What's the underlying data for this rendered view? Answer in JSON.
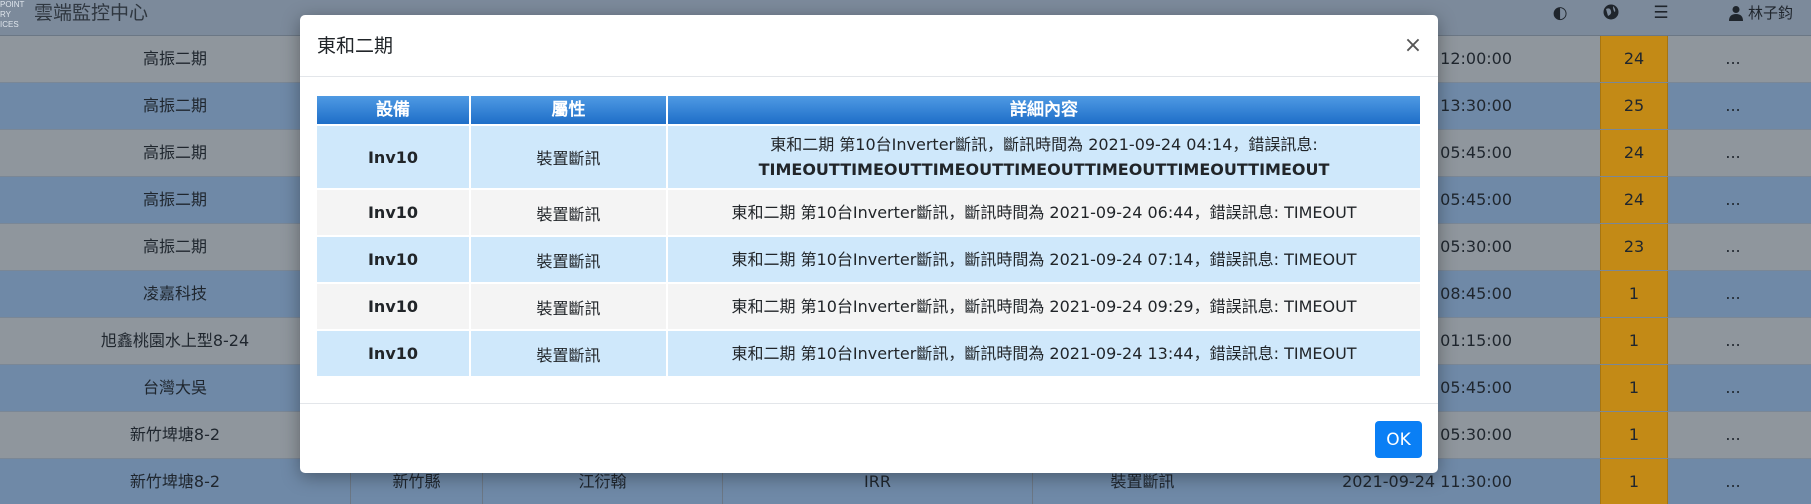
{
  "app": {
    "title": "雲端監控中心",
    "logo_text": "POINT\nRY\nICES",
    "nav_icons": [
      "contrast-icon",
      "globe-icon",
      "menu-icon"
    ],
    "user_name": "林子鈞"
  },
  "background_table": {
    "rows": [
      {
        "site": "高振二期",
        "time": "12:00:00",
        "count": "24",
        "more": "..."
      },
      {
        "site": "高振二期",
        "time": "13:30:00",
        "count": "25",
        "more": "..."
      },
      {
        "site": "高振二期",
        "time": "05:45:00",
        "count": "24",
        "more": "..."
      },
      {
        "site": "高振二期",
        "time": "05:45:00",
        "count": "24",
        "more": "..."
      },
      {
        "site": "高振二期",
        "time": "05:30:00",
        "count": "23",
        "more": "..."
      },
      {
        "site": "凌嘉科技",
        "time": "08:45:00",
        "count": "1",
        "more": "..."
      },
      {
        "site": "旭鑫桃園水上型8-24",
        "time": "01:15:00",
        "count": "1",
        "more": "..."
      },
      {
        "site": "台灣大吳",
        "time": "05:45:00",
        "count": "1",
        "more": "..."
      },
      {
        "site": "新竹埤塘8-2",
        "time": "05:30:00",
        "count": "1",
        "more": "..."
      },
      {
        "site": "新竹埤塘8-2",
        "county": "新竹縣",
        "owner": "江衍翰",
        "type": "IRR",
        "attr": "裝置斷訊",
        "time": "2021-09-24 11:30:00",
        "count": "1",
        "more": "..."
      }
    ]
  },
  "modal": {
    "title": "東和二期",
    "close_label": "×",
    "headers": [
      "設備",
      "屬性",
      "詳細內容"
    ],
    "rows": [
      {
        "device": "Inv10",
        "attribute": "裝置斷訊",
        "detail_line1": "東和二期 第10台Inverter斷訊，斷訊時間為 2021-09-24 04:14，錯誤訊息:",
        "detail_line2": "TIMEOUTTIMEOUTTIMEOUTTIMEOUTTIMEOUTTIMEOUTTIMEOUT"
      },
      {
        "device": "Inv10",
        "attribute": "裝置斷訊",
        "detail_line1": "東和二期 第10台Inverter斷訊，斷訊時間為 2021-09-24 06:44，錯誤訊息: TIMEOUT"
      },
      {
        "device": "Inv10",
        "attribute": "裝置斷訊",
        "detail_line1": "東和二期 第10台Inverter斷訊，斷訊時間為 2021-09-24 07:14，錯誤訊息: TIMEOUT"
      },
      {
        "device": "Inv10",
        "attribute": "裝置斷訊",
        "detail_line1": "東和二期 第10台Inverter斷訊，斷訊時間為 2021-09-24 09:29，錯誤訊息: TIMEOUT"
      },
      {
        "device": "Inv10",
        "attribute": "裝置斷訊",
        "detail_line1": "東和二期 第10台Inverter斷訊，斷訊時間為 2021-09-24 13:44，錯誤訊息: TIMEOUT"
      }
    ],
    "ok_label": "OK"
  },
  "colors": {
    "header_gradient_top": "#4f9ae3",
    "header_gradient_bottom": "#1e6ec8",
    "row_blue": "#cfe8fb",
    "row_grey": "#f4f4f4",
    "ok_button": "#0a7ff5",
    "count_cell": "#c38a16"
  }
}
